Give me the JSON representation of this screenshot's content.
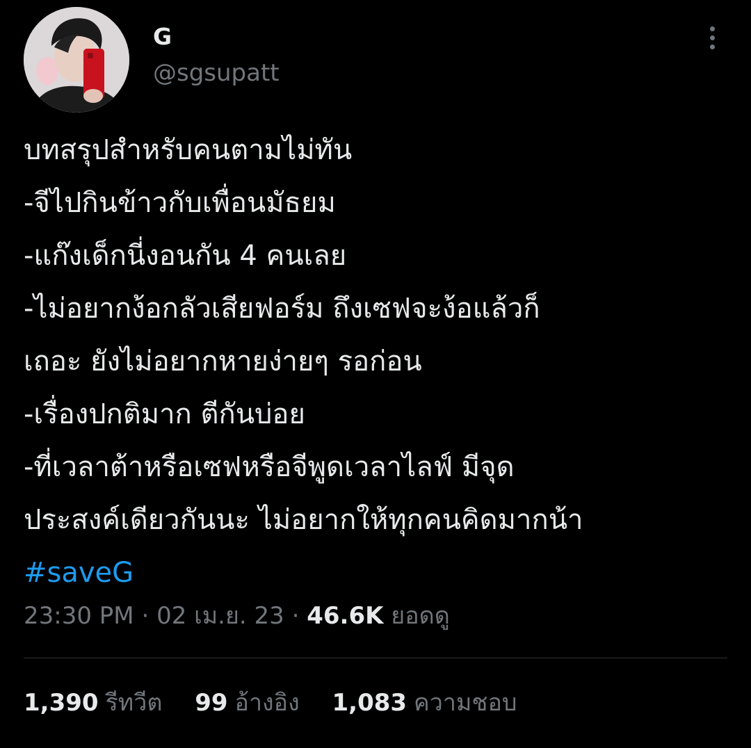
{
  "author": {
    "display_name": "G",
    "handle": "@sgsupatt"
  },
  "tweet": {
    "lines": [
      "บทสรุปสำหรับคนตามไม่ทัน",
      "-จีไปกินข้าวกับเพื่อนมัธยม",
      "-แก๊งเด็กนี่งอนกัน 4 คนเลย",
      "-ไม่อยากง้อกลัวเสียฟอร์ม ถึงเซฟจะง้อแล้วก็",
      "เถอะ ยังไม่อยากหายง่ายๆ รอก่อน",
      "-เรื่องปกติมาก ตีกันบ่อย",
      "-ที่เวลาต้าหรือเซฟหรือจีพูดเวลาไลฟ์ มีจุด",
      "ประสงค์เดียวกันนะ ไม่อยากให้ทุกคนคิดมากน้า"
    ],
    "hashtag": "#saveG"
  },
  "meta": {
    "time": "23:30 PM",
    "separator": " · ",
    "date": "02 เม.ย. 23",
    "views_count": "46.6K",
    "views_label": "ยอดดู"
  },
  "stats": {
    "retweets_count": "1,390",
    "retweets_label": "รีทวีต",
    "quotes_count": "99",
    "quotes_label": "อ้างอิง",
    "likes_count": "1,083",
    "likes_label": "ความชอบ"
  },
  "icons": {
    "more": "more-vertical-icon"
  },
  "colors": {
    "background": "#000000",
    "text_primary": "#e7e9ea",
    "text_secondary": "#71767b",
    "accent": "#1d9bf0",
    "divider": "#2f3336"
  }
}
